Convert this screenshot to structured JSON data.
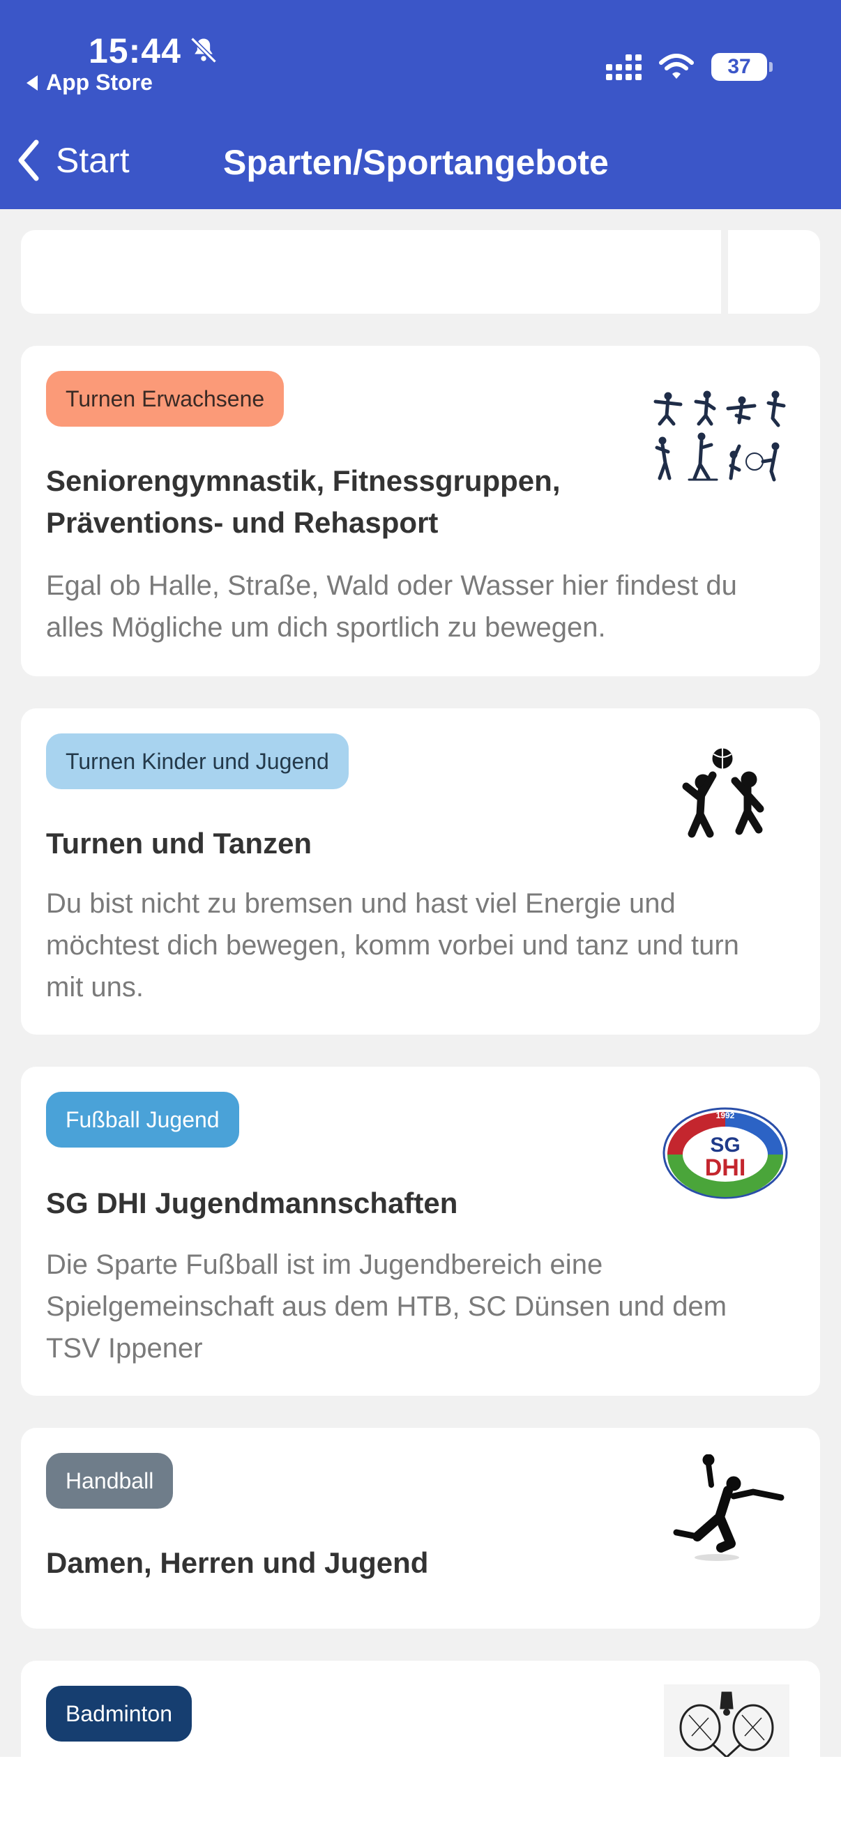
{
  "status_bar": {
    "time": "15:44",
    "back_app": "App Store",
    "battery": "37"
  },
  "nav": {
    "back_label": "Start",
    "title": "Sparten/Sportangebote"
  },
  "cards": [
    {
      "tag": "Turnen Erwachsene",
      "tag_bg": "#fb9a78",
      "tag_color": "#3a2a25",
      "title_lines": [
        "Seniorengymnastik, Fitnessgruppen,",
        "Präventions- und Rehasport"
      ],
      "desc_lines": [
        "Egal ob Halle, Straße, Wald oder Wasser hier findest du",
        "alles Mögliche um dich sportlich zu bewegen."
      ],
      "image_icon": "gymnastics-silhouettes-icon"
    },
    {
      "tag": "Turnen Kinder und Jugend",
      "tag_bg": "#a8d3ef",
      "tag_color": "#23394a",
      "title_lines": [
        "Turnen und Tanzen"
      ],
      "desc_lines": [
        "Du bist nicht zu bremsen und hast viel Energie und",
        "möchtest dich bewegen, komm vorbei und tanz und turn",
        "mit uns."
      ],
      "image_icon": "kids-ball-icon"
    },
    {
      "tag": "Fußball Jugend",
      "tag_bg": "#4aa2d8",
      "tag_color": "#ffffff",
      "title_lines": [
        "SG DHI Jugendmannschaften"
      ],
      "desc_lines": [
        "Die Sparte Fußball ist im Jugendbereich eine",
        "Spielgemeinschaft aus dem HTB, SC Dünsen und dem",
        "TSV Ippener"
      ],
      "image_icon": "sg-dhi-logo",
      "logo": {
        "year": "1992",
        "line1": "SG",
        "line2": "DHI"
      }
    },
    {
      "tag": "Handball",
      "tag_bg": "#6f7d8a",
      "tag_color": "#ffffff",
      "title_lines": [
        "Damen, Herren und Jugend"
      ],
      "desc_lines": [],
      "image_icon": "handball-player-icon"
    },
    {
      "tag": "Badminton",
      "tag_bg": "#163e70",
      "tag_color": "#ffffff",
      "title_lines": [],
      "desc_lines": [],
      "image_icon": "badminton-rackets-icon"
    }
  ]
}
